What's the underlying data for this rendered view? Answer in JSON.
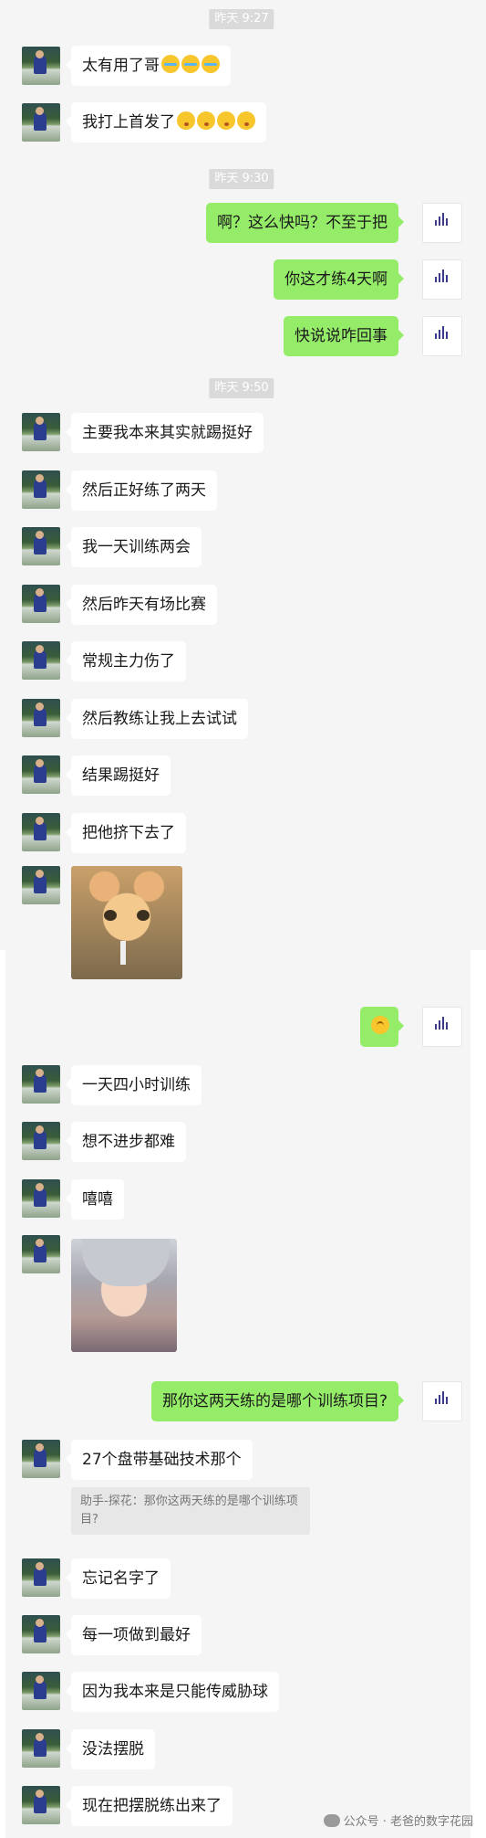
{
  "timestamps": [
    "昨天 9:27",
    "昨天 9:30",
    "昨天 9:50"
  ],
  "messages": {
    "m1": "太有用了哥",
    "m2": "我打上首发了",
    "m3": "啊？这么快吗？不至于把",
    "m4": "你这才练4天啊",
    "m5": "快说说咋回事",
    "m6": "主要我本来其实就踢挺好",
    "m7": "然后正好练了两天",
    "m8": "我一天训练两会",
    "m9": "然后昨天有场比赛",
    "m10": "常规主力伤了",
    "m11": "然后教练让我上去试试",
    "m12": "结果踢挺好",
    "m13": "把他挤下去了",
    "m15": "一天四小时训练",
    "m16": "想不进步都难",
    "m17": "嘻嘻",
    "m19": "那你这两天练的是哪个训练项目?",
    "m20": "27个盘带基础技术那个",
    "m21": "忘记名字了",
    "m22": "每一项做到最好",
    "m23": "因为我本来是只能传威胁球",
    "m24": "没法摆脱",
    "m25": "现在把摆脱练出来了"
  },
  "quote": "助手-探花：那你这两天练的是哪个训练项目?",
  "watermark": "公众号 · 老爸的数字花园",
  "icons": {
    "crying": "loudly-crying-face-emoji",
    "kiss": "kissing-face-emoji",
    "thinking": "thinking-face-emoji",
    "user_avatar": "soccer-player-avatar",
    "my_avatar": "bar-logo-avatar"
  },
  "colors": {
    "my_bubble": "#95ec69",
    "their_bubble": "#ffffff",
    "background": "#f5f5f5"
  }
}
